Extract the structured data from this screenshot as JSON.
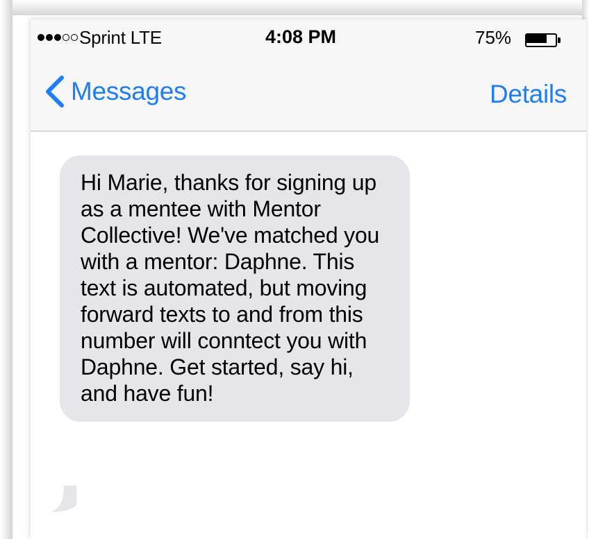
{
  "status_bar": {
    "signal_full": 3,
    "signal_empty": 2,
    "carrier": "Sprint  LTE",
    "time": "4:08 PM",
    "battery_percent_label": "75%",
    "battery_level": 0.75
  },
  "nav": {
    "back_label": "Messages",
    "details_label": "Details"
  },
  "messages": [
    {
      "direction": "incoming",
      "text": "Hi Marie, thanks for signing up as a mentee with Mentor Collective! We've matched you with a mentor: Daphne. This text is automated, but moving forward texts to and from this number will conntect you with Daphne. Get started, say hi, and have fun!"
    }
  ],
  "colors": {
    "accent": "#1f7ef5",
    "header_bg": "#f7f7f8",
    "bubble_incoming": "#e5e5ea",
    "text": "#000000"
  },
  "icons": {
    "back": "chevron-left-icon",
    "battery": "battery-icon",
    "signal": "signal-dots-icon"
  }
}
